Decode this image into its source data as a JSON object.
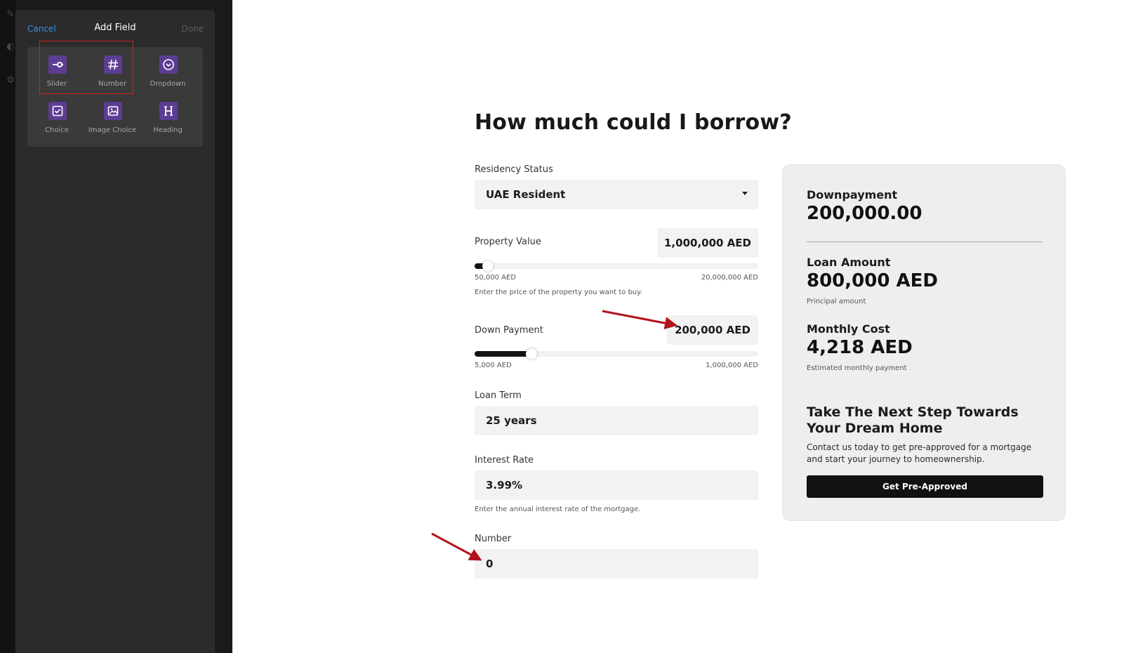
{
  "sidebar": {
    "cancel": "Cancel",
    "title": "Add Field",
    "done": "Done",
    "fields": [
      {
        "label": "Slider",
        "icon": "slider-icon"
      },
      {
        "label": "Number",
        "icon": "hash-icon"
      },
      {
        "label": "Dropdown",
        "icon": "dropdown-circle-icon"
      },
      {
        "label": "Choice",
        "icon": "checkbox-icon"
      },
      {
        "label": "Image Choice",
        "icon": "image-icon"
      },
      {
        "label": "Heading",
        "icon": "heading-icon"
      }
    ],
    "accent": "#5d3d93",
    "highlight_color": "#d42020"
  },
  "form": {
    "title": "How much could I borrow?",
    "residency": {
      "label": "Residency Status",
      "value": "UAE Resident"
    },
    "property": {
      "label": "Property Value",
      "value": "1,000,000 AED",
      "min": "50,000 AED",
      "max": "20,000,000 AED",
      "hint": "Enter the price of the property you want to buy.",
      "slider_fraction": 0.048
    },
    "down_payment": {
      "label": "Down Payment",
      "value": "200,000 AED",
      "min": "5,000 AED",
      "max": "1,000,000 AED",
      "slider_fraction": 0.2
    },
    "loan_term": {
      "label": "Loan Term",
      "value": "25 years"
    },
    "interest": {
      "label": "Interest Rate",
      "value": "3.99%",
      "hint": "Enter the annual interest rate of the mortgage."
    },
    "number": {
      "label": "Number",
      "value": "0"
    }
  },
  "summary": {
    "downpayment_label": "Downpayment",
    "downpayment_value": "200,000.00",
    "loan_label": "Loan Amount",
    "loan_value": "800,000 AED",
    "loan_sub": "Principal amount",
    "monthly_label": "Monthly Cost",
    "monthly_value": "4,218 AED",
    "monthly_sub": "Estimated monthly payment",
    "cta_title": "Take The Next Step Towards Your Dream Home",
    "cta_text": "Contact us today to get pre-approved for a mortgage and start your journey to homeownership.",
    "cta_button": "Get Pre-Approved"
  },
  "annotation_color": "#b3121b"
}
